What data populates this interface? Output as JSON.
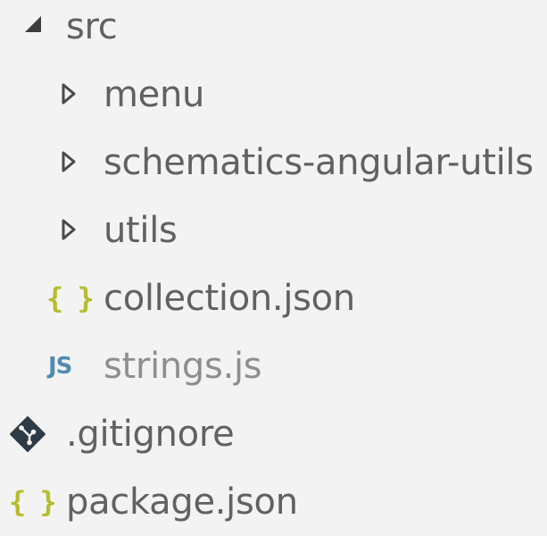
{
  "explorer": {
    "items": [
      {
        "label": "src",
        "icon": "caret-expanded-icon"
      },
      {
        "label": "menu",
        "icon": "caret-collapsed-icon"
      },
      {
        "label": "schematics-angular-utils",
        "icon": "caret-collapsed-icon"
      },
      {
        "label": "utils",
        "icon": "caret-collapsed-icon"
      },
      {
        "label": "collection.json",
        "icon": "json-braces-icon",
        "icon_text": "{ }"
      },
      {
        "label": "strings.js",
        "icon": "javascript-file-icon",
        "icon_text": "JS"
      },
      {
        "label": ".gitignore",
        "icon": "git-diamond-icon"
      },
      {
        "label": "package.json",
        "icon": "json-braces-icon",
        "icon_text": "{ }"
      }
    ]
  },
  "colors": {
    "background": "#f3f3f3",
    "text": "#616161",
    "text_dim": "#8e8e8e",
    "json_icon": "#b5bd2e",
    "js_icon": "#4f8bb0",
    "git_icon": "#2e3a46"
  }
}
